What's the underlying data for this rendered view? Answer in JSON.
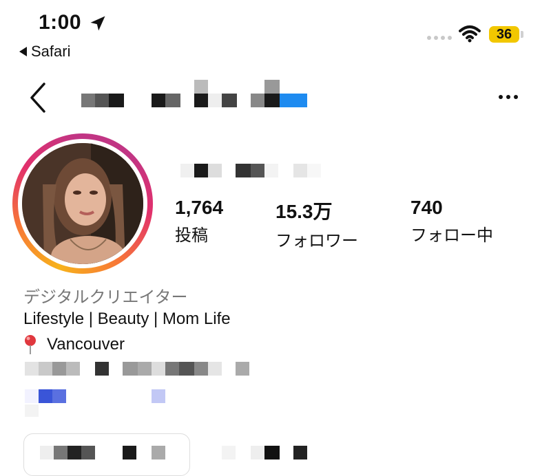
{
  "status_bar": {
    "time": "1:00",
    "back_app": "Safari",
    "battery": "36",
    "battery_color": "#f2c700"
  },
  "nav": {
    "back_icon": "chevron-left-icon",
    "more_icon": "ellipsis-icon"
  },
  "stats": [
    {
      "value": "1,764",
      "label": "投稿"
    },
    {
      "value": "15.3万",
      "label": "フォロワー"
    },
    {
      "value": "740",
      "label": "フォロー中"
    }
  ],
  "bio": {
    "category": "デジタルクリエイター",
    "tagline": "Lifestyle | Beauty | Mom Life",
    "location": "Vancouver",
    "location_icon": "pin-icon"
  },
  "colors": {
    "ring_gradient": [
      "#f7b21b",
      "#e1306c",
      "#c13584"
    ],
    "link_blue": "#3a55d8",
    "accent_blue": "#1e8bf0"
  }
}
